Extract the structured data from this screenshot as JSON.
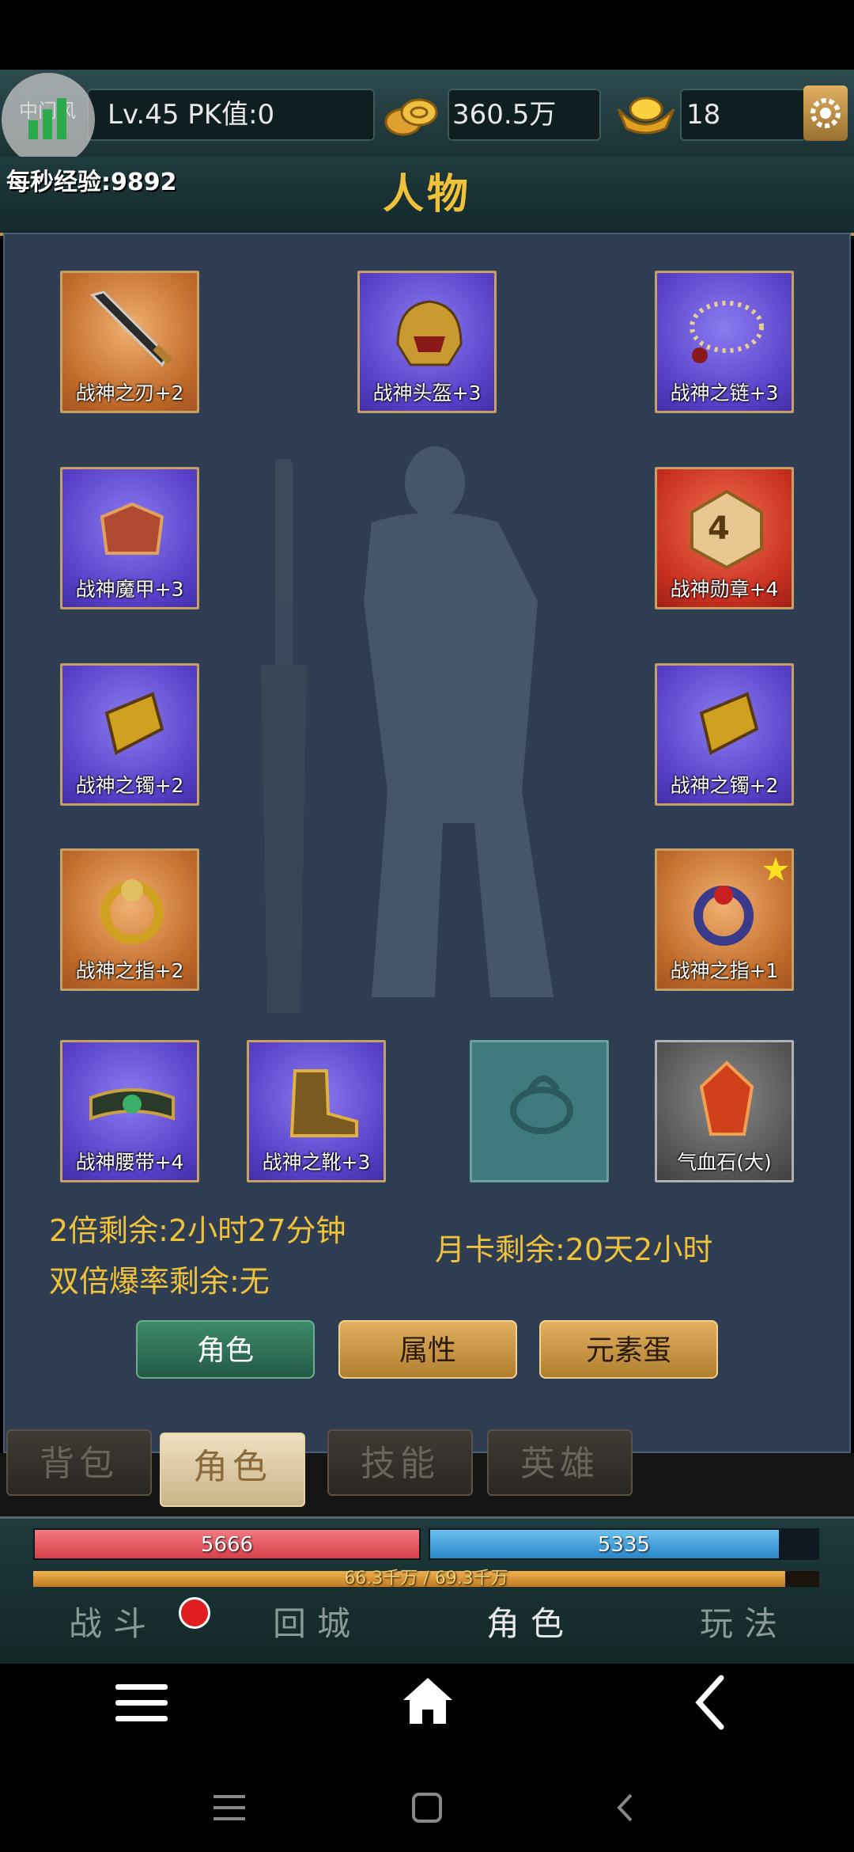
{
  "topbar": {
    "server": "中门风",
    "level_pk": "Lv.45 PK值:0",
    "gold": "360.5万",
    "ingot": "18"
  },
  "exp_per_sec": "每秒经验:9892",
  "page_title": "人物",
  "equipment": [
    {
      "label": "战神之刃+2",
      "icon": "sword-icon",
      "rarity": "orange"
    },
    {
      "label": "战神头盔+3",
      "icon": "helmet-icon",
      "rarity": "purple"
    },
    {
      "label": "战神之链+3",
      "icon": "necklace-icon",
      "rarity": "purple"
    },
    {
      "label": "战神魔甲+3",
      "icon": "armor-icon",
      "rarity": "purple"
    },
    {
      "label": "战神勋章+4",
      "icon": "medal-icon",
      "rarity": "red",
      "medal_number": "4"
    },
    {
      "label": "战神之镯+2",
      "icon": "bracelet-icon",
      "rarity": "purple"
    },
    {
      "label": "战神之镯+2",
      "icon": "bracelet-icon",
      "rarity": "purple"
    },
    {
      "label": "战神之指+2",
      "icon": "ring-icon",
      "rarity": "orange"
    },
    {
      "label": "战神之指+1",
      "icon": "ring-icon",
      "rarity": "orange",
      "starred": true
    },
    {
      "label": "战神腰带+4",
      "icon": "belt-icon",
      "rarity": "purple"
    },
    {
      "label": "战神之靴+3",
      "icon": "boots-icon",
      "rarity": "purple"
    },
    {
      "label": "",
      "icon": "empty-ring-slot-icon",
      "rarity": "empty"
    },
    {
      "label": "气血石(大)",
      "icon": "blood-stone-icon",
      "rarity": "gray"
    }
  ],
  "status": {
    "double_exp": "2倍剩余:2小时27分钟",
    "double_drop": "双倍爆率剩余:无",
    "month_card": "月卡剩余:20天2小时"
  },
  "buttons": {
    "role": "角色",
    "attributes": "属性",
    "element_egg": "元素蛋"
  },
  "tabs": [
    {
      "label": "背包",
      "active": false
    },
    {
      "label": "角色",
      "active": true
    },
    {
      "label": "技能",
      "active": false
    },
    {
      "label": "英雄",
      "active": false
    }
  ],
  "hud": {
    "hp": "5666",
    "hp_fill": 1.0,
    "mp": "5335",
    "mp_fill": 0.9,
    "exp": "66.3千万 / 69.3千万",
    "exp_fill": 0.957
  },
  "bottom_nav": [
    "战斗",
    "回城",
    "角色",
    "玩法"
  ],
  "colors": {
    "gold_text": "#f0c23a",
    "hp": "#e8505a",
    "mp": "#3a9ad8",
    "panel": "#2e3d52"
  }
}
